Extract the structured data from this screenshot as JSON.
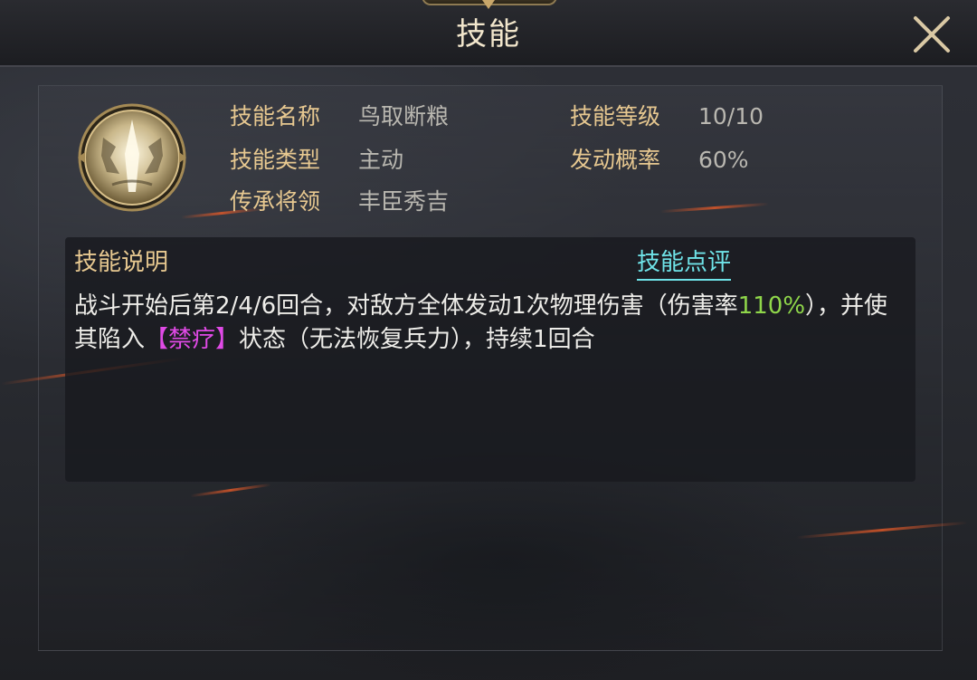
{
  "header": {
    "title": "技能"
  },
  "skill": {
    "labels": {
      "name": "技能名称",
      "level": "技能等级",
      "type": "技能类型",
      "chance": "发动概率",
      "inherit": "传承将领"
    },
    "values": {
      "name": "鸟取断粮",
      "level": "10/10",
      "type": "主动",
      "chance": "60%",
      "inherit": "丰臣秀吉"
    }
  },
  "description": {
    "title": "技能说明",
    "review_link": "技能点评",
    "part1": "战斗开始后第2/4/6回合，对敌方全体发动1次物理伤害（伤害率",
    "rate": "110%",
    "part2": "），并使其陷入",
    "status": "【禁疗】",
    "part3": "状态（无法恢复兵力），持续1回合"
  },
  "colors": {
    "label_gold": "#e7c890",
    "value_gray": "#b9b7b0",
    "link_cyan": "#6fe3e8",
    "highlight_green": "#8fd64a",
    "highlight_magenta": "#e04ae6"
  }
}
